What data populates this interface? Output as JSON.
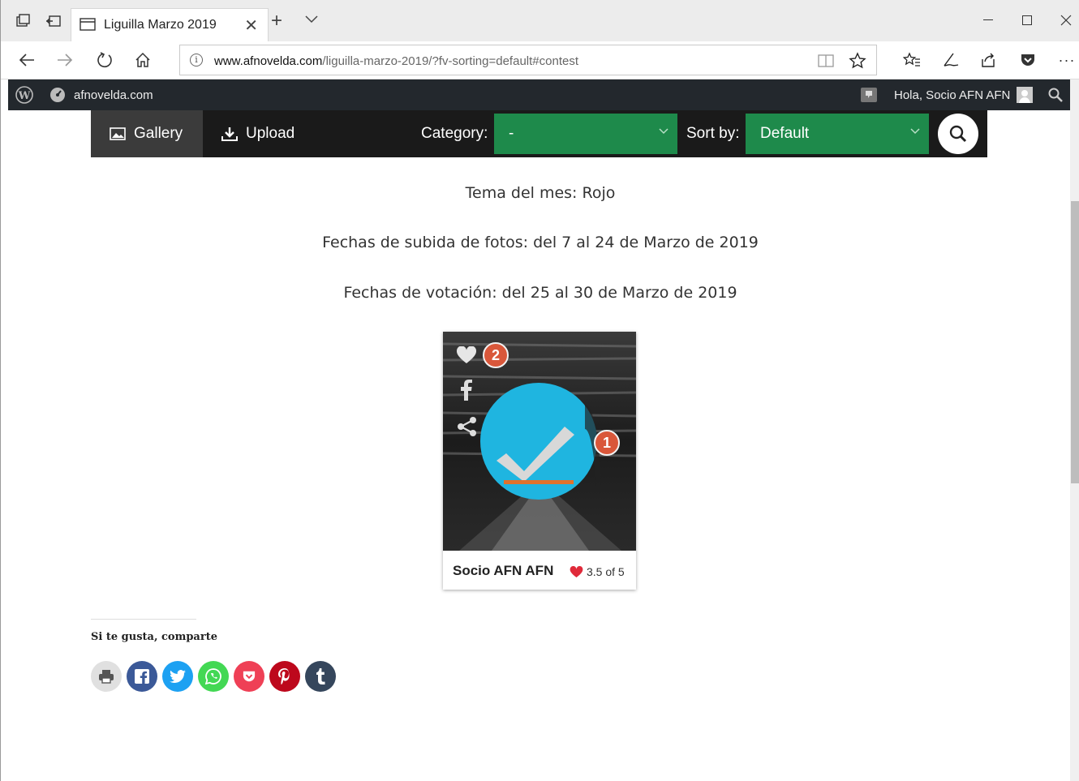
{
  "browser": {
    "tab_title": "Liguilla Marzo 2019",
    "url_domain": "www.afnovelda.com",
    "url_path": "/liguilla-marzo-2019/?fv-sorting=default#contest"
  },
  "wpbar": {
    "site_name": "afnovelda.com",
    "greeting": "Hola, Socio AFN AFN"
  },
  "gallery_toolbar": {
    "gallery_label": "Gallery",
    "upload_label": "Upload",
    "category_label": "Category:",
    "category_value": "-",
    "sort_label": "Sort by:",
    "sort_value": "Default"
  },
  "content": {
    "theme_line": "Tema del mes: Rojo",
    "upload_dates": "Fechas de subida de fotos: del 7 al 24 de Marzo de 2019",
    "vote_dates": "Fechas de votación: del 25 al 30 de Marzo de 2019"
  },
  "photo_card": {
    "like_count": "2",
    "badge_number": "1",
    "author": "Socio AFN AFN",
    "rating": "3.5 of 5"
  },
  "share": {
    "title": "Si te gusta, comparte",
    "buttons": [
      {
        "name": "print",
        "color": "#e0e0e0"
      },
      {
        "name": "facebook",
        "color": "#3b5998"
      },
      {
        "name": "twitter",
        "color": "#1da1f2"
      },
      {
        "name": "whatsapp",
        "color": "#43d854"
      },
      {
        "name": "pocket",
        "color": "#ef4056"
      },
      {
        "name": "pinterest",
        "color": "#bd081c"
      },
      {
        "name": "tumblr",
        "color": "#35465c"
      }
    ]
  },
  "colors": {
    "select_green": "#1e8a4b",
    "toolbar_dark": "#1a1a1a",
    "badge_orange": "#d9573a"
  }
}
